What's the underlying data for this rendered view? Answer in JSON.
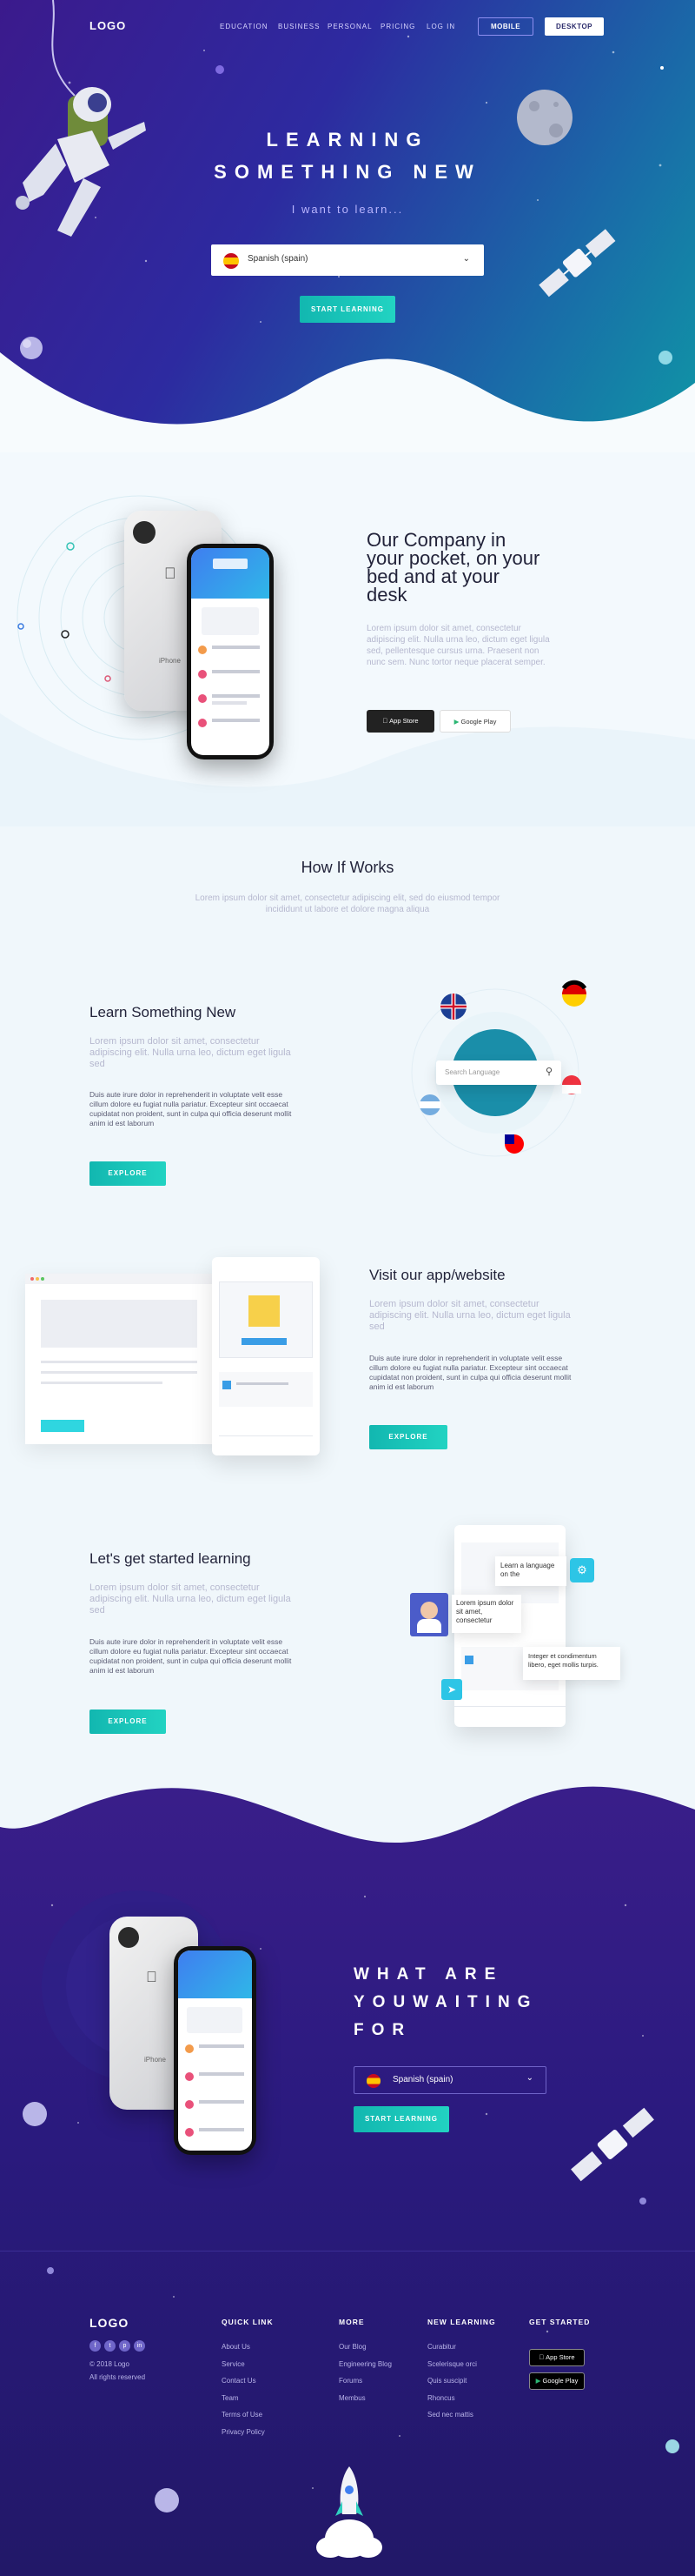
{
  "nav": {
    "logo": "LOGO",
    "items": [
      "EDUCATION",
      "BUSINESS",
      "PERSONAL",
      "PRICING",
      "LOG IN"
    ],
    "mobile": "MOBILE",
    "desktop": "DESKTOP"
  },
  "hero": {
    "title1": "LEARNING",
    "title2": "SOMETHING NEW",
    "subtitle": "I want to learn...",
    "select": "Spanish (spain)",
    "cta": "START LEARNING"
  },
  "company": {
    "title": "Our Company in your pocket, on your bed and at your desk",
    "body": "Lorem ipsum dolor sit amet, consectetur adipiscing elit. Nulla urna leo, dictum eget ligula sed, pellentesque cursus urna. Praesent non nunc sem. Nunc tortor neque placerat semper.",
    "appstore": "App Store",
    "googleplay": "Google Play",
    "phone_label": "iPhone"
  },
  "how": {
    "title": "How If Works",
    "body": "Lorem ipsum dolor sit amet, consectetur adipiscing elit, sed do eiusmod tempor incididunt ut labore et dolore magna aliqua"
  },
  "learn": {
    "title": "Learn Something New",
    "lead": "Lorem ipsum dolor sit amet, consectetur adipiscing elit. Nulla urna leo, dictum eget ligula sed",
    "body": "Duis aute irure dolor in reprehenderit in voluptate velit esse cillum dolore eu fugiat nulla pariatur. Excepteur sint occaecat cupidatat non proident, sunt in culpa qui officia deserunt mollit anim id est laborum",
    "btn": "EXPLORE",
    "search": "Search Language"
  },
  "visit": {
    "title": "Visit our app/website",
    "lead": "Lorem ipsum dolor sit amet, consectetur adipiscing elit. Nulla urna leo, dictum eget ligula sed",
    "body": "Duis aute irure dolor in reprehenderit in voluptate velit esse cillum dolore eu fugiat nulla pariatur. Excepteur sint occaecat cupidatat non proident, sunt in culpa qui officia deserunt mollit anim id est laborum",
    "btn": "EXPLORE"
  },
  "started": {
    "title": "Let's get started learning",
    "lead": "Lorem ipsum dolor sit amet, consectetur adipiscing elit. Nulla urna leo, dictum eget ligula sed",
    "body": "Duis aute irure dolor in reprehenderit in voluptate velit esse cillum dolore eu fugiat nulla pariatur. Excepteur sint occaecat cupidatat non proident, sunt in culpa qui officia deserunt mollit anim id est laborum",
    "btn": "EXPLORE",
    "bubble1": "Learn a language on the",
    "bubble2": "Lorem ipsum dolor sit amet, consectetur",
    "bubble3": "Integer et condimentum libero, eget mollis turpis."
  },
  "waiting": {
    "line1": "WHAT ARE",
    "line2": "YOUWAITING",
    "line3": "FOR",
    "select": "Spanish (spain)",
    "cta": "START LEARNING",
    "phone_label": "iPhone"
  },
  "footer": {
    "logo": "LOGO",
    "copy1": "© 2018 Logo",
    "copy2": "All rights reserved",
    "quick": {
      "title": "QUICK LINK",
      "items": [
        "About Us",
        "Service",
        "Contact Us",
        "Team",
        "Terms of Use",
        "Privacy Policy"
      ]
    },
    "more": {
      "title": "MORE",
      "items": [
        "Our Blog",
        "Engineering Blog",
        "Forums",
        "Membus"
      ]
    },
    "newl": {
      "title": "NEW LEARNING",
      "items": [
        "Curabitur",
        "Scelerisque orci",
        "Quis suscipit",
        "Rhoncus",
        "Sed nec mattis"
      ]
    },
    "get": {
      "title": "GET STARTED",
      "appstore": "App Store",
      "googleplay": "Google Play"
    }
  },
  "colors": {
    "accent": "#17c2b6",
    "hero_start": "#3b1a8c",
    "hero_end": "#0f97a6",
    "dark_bg": "#2a1a7e"
  }
}
